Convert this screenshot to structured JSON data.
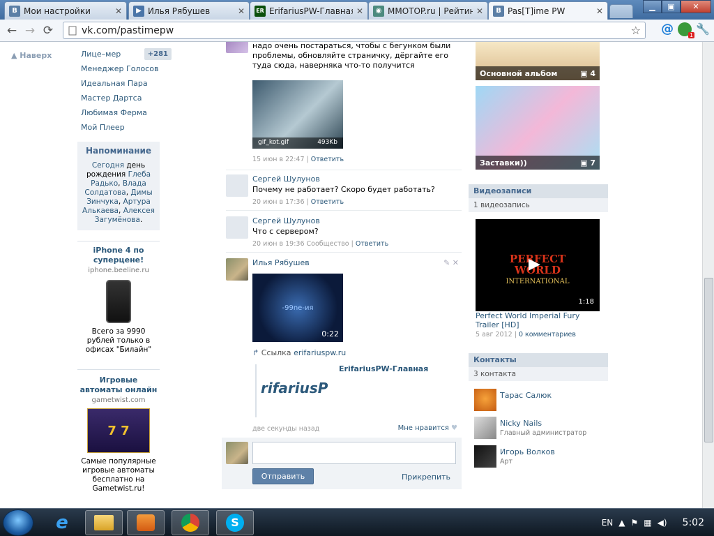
{
  "tabs": [
    {
      "title": "Мои настройки",
      "fav": "В",
      "color": "#5b7fa6",
      "active": false
    },
    {
      "title": "Илья Рябушев",
      "fav": "▶",
      "color": "#4a75a8",
      "active": false
    },
    {
      "title": "ErifariusPW-Главная",
      "fav": "ER",
      "color": "#0b4f0b",
      "active": false
    },
    {
      "title": "MMOTOP.ru | Рейтинг с",
      "fav": "◉",
      "color": "#4b8a7e",
      "active": false
    },
    {
      "title": "Pas[T]ime PW",
      "fav": "В",
      "color": "#5b7fa6",
      "active": true
    }
  ],
  "tab_close": "✕",
  "window_buttons": {
    "minimize": "▁",
    "maximize": "▣",
    "close": "✕"
  },
  "toolbar": {
    "url": "vk.com/pastimepw",
    "ext_badge": "1"
  },
  "left": {
    "top_link": "▲ Наверх",
    "menu": [
      {
        "label": "Лице–мер",
        "badge": "+281"
      },
      {
        "label": "Менеджер Голосов"
      },
      {
        "label": "Идеальная Пара"
      },
      {
        "label": "Мастер Дартса"
      },
      {
        "label": "Любимая Ферма"
      },
      {
        "label": "Мой Плеер"
      }
    ],
    "reminder": {
      "title": "Напоминание",
      "today": "Сегодня",
      "birthday_word": "день рождения",
      "names": [
        "Глеба Радько",
        "Влада Солдатова",
        "Димы Зинчука",
        "Артура Алькаева",
        "Алексея Загумёнова"
      ]
    },
    "ads": [
      {
        "title": "iPhone 4 по суперцене!",
        "domain": "iphone.beeline.ru",
        "text": "Всего за 9990 рублей только в офисах \"Билайн\""
      },
      {
        "title": "Игровые автоматы онлайн",
        "domain": "gametwist.com",
        "text": "Самые популярные игровые автоматы бесплатно на Gametwist.ru!"
      }
    ]
  },
  "wall": {
    "post1": {
      "text": "надо очень постараться, чтобы с бегунком были проблемы, обновляйте страничку, дёргайте его туда сюда, наверняка что-то получится",
      "gif_name": "gif_kot.gif",
      "gif_size": "493Kb",
      "date": "15 июн в 22:47",
      "reply": "Ответить"
    },
    "post2": {
      "author": "Сергей Шулунов",
      "text": "Почему не работает? Скоро будет работать?",
      "date": "20 июн в 17:36",
      "reply": "Ответить"
    },
    "post3": {
      "author": "Сергей Шулунов",
      "text": "Что с сервером?",
      "date": "20 июн в 19:36",
      "community": "Сообщество",
      "reply": "Ответить"
    },
    "post4": {
      "author": "Илья Рябушев",
      "video_text": "-99ne-ия",
      "video_duration": "0:22",
      "link_label": "Ссылка",
      "link_url": "erifariuspw.ru",
      "site_title": "ErifariusPW-Главная",
      "site_logo": "rifariusP",
      "time": "две секунды назад",
      "like": "Мне нравится"
    },
    "compose": {
      "send": "Отправить",
      "attach": "Прикрепить"
    }
  },
  "right": {
    "albums": [
      {
        "name": "Основной альбом",
        "count": "4"
      },
      {
        "name": "Заставки))",
        "count": "7"
      }
    ],
    "videos": {
      "title": "Видеозаписи",
      "count": "1 видеозапись",
      "video_title": "Perfect World Imperial Fury Trailer [HD]",
      "duration": "1:18",
      "date": "5 авг 2012",
      "comments": "0 комментариев",
      "logo1": "PERFECT",
      "logo2": "WORLD",
      "logo3": "INTERNATIONAL"
    },
    "contacts": {
      "title": "Контакты",
      "count": "3 контакта",
      "items": [
        {
          "name": "Тарас Салюк",
          "role": ""
        },
        {
          "name": "Nicky Nails",
          "role": "Главный администратор"
        },
        {
          "name": "Игорь Волков",
          "role": "Арт"
        }
      ]
    }
  },
  "taskbar": {
    "lang": "EN",
    "clock": "5:02"
  }
}
